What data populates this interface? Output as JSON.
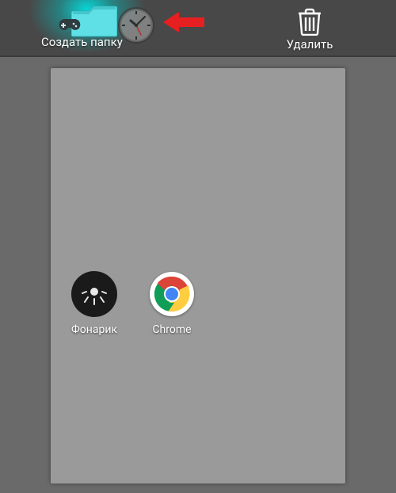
{
  "topbar": {
    "create_folder_label": "Создать папку",
    "delete_label": "Удалить"
  },
  "apps": {
    "flashlight": {
      "label": "Фонарик"
    },
    "chrome": {
      "label": "Chrome"
    }
  },
  "dragged_app": {
    "name": "Часы"
  },
  "annotation": {
    "arrow_color": "#e62020"
  },
  "colors": {
    "glow": "#00e6e6",
    "folder": "#5fe0e6",
    "panel": "#9a9a9a",
    "topbar": "#484848",
    "clock_red": "#c53030",
    "clock_dark": "#2a2a2a"
  }
}
